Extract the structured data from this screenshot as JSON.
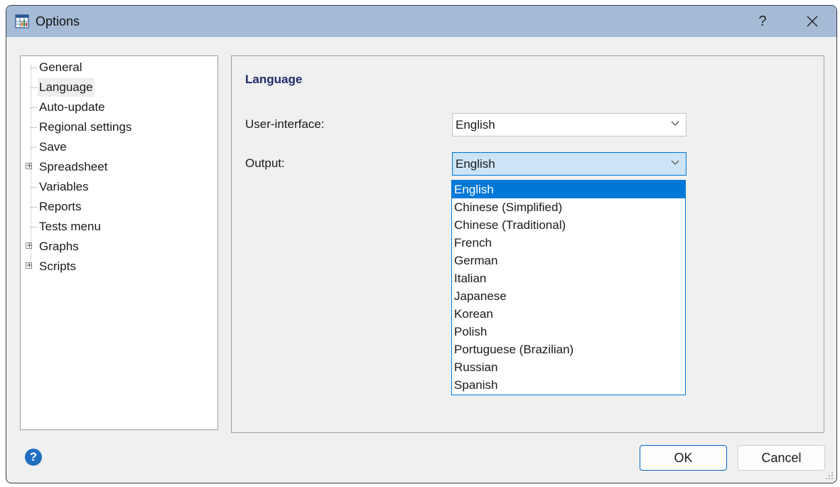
{
  "window": {
    "title": "Options",
    "help_glyph": "?",
    "close_glyph": "✕"
  },
  "tree": {
    "items": [
      {
        "label": "General",
        "expandable": false,
        "selected": false
      },
      {
        "label": "Language",
        "expandable": false,
        "selected": true
      },
      {
        "label": "Auto-update",
        "expandable": false,
        "selected": false
      },
      {
        "label": "Regional settings",
        "expandable": false,
        "selected": false
      },
      {
        "label": "Save",
        "expandable": false,
        "selected": false
      },
      {
        "label": "Spreadsheet",
        "expandable": true,
        "selected": false
      },
      {
        "label": "Variables",
        "expandable": false,
        "selected": false
      },
      {
        "label": "Reports",
        "expandable": false,
        "selected": false
      },
      {
        "label": "Tests menu",
        "expandable": false,
        "selected": false
      },
      {
        "label": "Graphs",
        "expandable": true,
        "selected": false
      },
      {
        "label": "Scripts",
        "expandable": true,
        "selected": false
      }
    ]
  },
  "language": {
    "section_title": "Language",
    "user_interface_label": "User-interface:",
    "user_interface_value": "English",
    "output_label": "Output:",
    "output_value": "English",
    "output_options": [
      "English",
      "Chinese (Simplified)",
      "Chinese (Traditional)",
      "French",
      "German",
      "Italian",
      "Japanese",
      "Korean",
      "Polish",
      "Portuguese (Brazilian)",
      "Russian",
      "Spanish"
    ],
    "highlighted_option": "English"
  },
  "footer": {
    "help_glyph": "?",
    "ok_label": "OK",
    "cancel_label": "Cancel"
  },
  "colors": {
    "titlebar": "#a5bbd6",
    "accent": "#0078d7",
    "section_title": "#1f2a6b"
  }
}
